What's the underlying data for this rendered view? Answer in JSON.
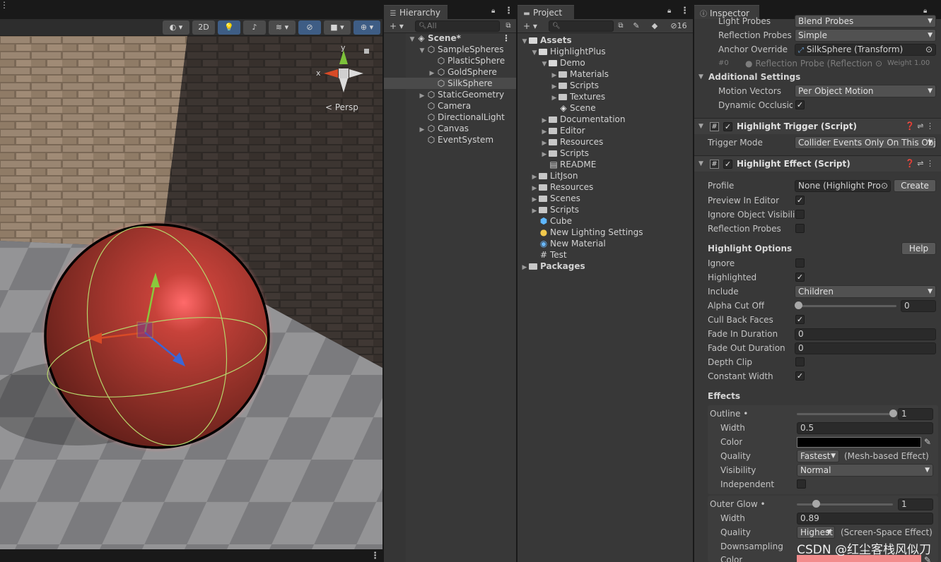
{
  "scene": {
    "toolbar": {
      "btn_2d": "2D"
    },
    "gizmo": {
      "y_label": "y",
      "x_label": "x",
      "persp_label": "< Persp"
    }
  },
  "hierarchy": {
    "tab_label": "Hierarchy",
    "search_placeholder": "All",
    "items": [
      {
        "label": "Scene*",
        "bold": true
      },
      {
        "label": "SampleSpheres"
      },
      {
        "label": "PlasticSphere"
      },
      {
        "label": "GoldSphere"
      },
      {
        "label": "SilkSphere",
        "selected": true
      },
      {
        "label": "StaticGeometry"
      },
      {
        "label": "Camera"
      },
      {
        "label": "DirectionalLight"
      },
      {
        "label": "Canvas"
      },
      {
        "label": "EventSystem"
      }
    ]
  },
  "project": {
    "tab_label": "Project",
    "hidden_count": "16",
    "items": [
      {
        "label": "Assets",
        "bold": true
      },
      {
        "label": "HighlightPlus"
      },
      {
        "label": "Demo"
      },
      {
        "label": "Materials"
      },
      {
        "label": "Scripts"
      },
      {
        "label": "Textures"
      },
      {
        "label": "Scene"
      },
      {
        "label": "Documentation"
      },
      {
        "label": "Editor"
      },
      {
        "label": "Resources"
      },
      {
        "label": "Scripts"
      },
      {
        "label": "README"
      },
      {
        "label": "LitJson"
      },
      {
        "label": "Resources"
      },
      {
        "label": "Scenes"
      },
      {
        "label": "Scripts"
      },
      {
        "label": "Cube"
      },
      {
        "label": "New Lighting Settings"
      },
      {
        "label": "New Material"
      },
      {
        "label": "Test"
      },
      {
        "label": "Packages",
        "bold": true
      }
    ]
  },
  "inspector": {
    "tab_label": "Inspector",
    "light_probes": {
      "label": "Light Probes",
      "value": "Blend Probes"
    },
    "reflection_probes": {
      "label": "Reflection Probes",
      "value": "Simple"
    },
    "anchor_override": {
      "label": "Anchor Override",
      "value": "SilkSphere (Transform)"
    },
    "probe_line": {
      "index": "#0",
      "value": "Reflection Probe (Reflection P",
      "weight": "Weight 1.00"
    },
    "additional_settings": "Additional Settings",
    "motion_vectors": {
      "label": "Motion Vectors",
      "value": "Per Object Motion"
    },
    "dynamic_occlusion": {
      "label": "Dynamic Occlusion"
    },
    "trigger_component": {
      "title": "Highlight Trigger (Script)"
    },
    "trigger_mode": {
      "label": "Trigger Mode",
      "value": "Collider Events Only On This Obj"
    },
    "effect_component": {
      "title": "Highlight Effect (Script)"
    },
    "profile": {
      "label": "Profile",
      "value": "None (Highlight Profi",
      "create": "Create"
    },
    "preview_in_editor": "Preview In Editor",
    "ignore_object_visibility": "Ignore Object Visibility",
    "reflection_probes_toggle": "Reflection Probes",
    "highlight_options": {
      "title": "Highlight Options",
      "help": "Help"
    },
    "ignore": "Ignore",
    "highlighted": "Highlighted",
    "include": {
      "label": "Include",
      "value": "Children"
    },
    "alpha_cut_off": {
      "label": "Alpha Cut Off",
      "value": "0",
      "fraction": 0.0
    },
    "cull_back_faces": "Cull Back Faces",
    "fade_in_duration": {
      "label": "Fade In Duration",
      "value": "0"
    },
    "fade_out_duration": {
      "label": "Fade Out Duration",
      "value": "0"
    },
    "depth_clip": "Depth Clip",
    "constant_width": "Constant Width",
    "effects_title": "Effects",
    "outline": {
      "label": "Outline •",
      "value": "1",
      "fraction": 1.0,
      "width_label": "Width",
      "width": "0.5",
      "color_label": "Color",
      "color": "#000000",
      "quality_label": "Quality",
      "quality": "Fastest",
      "quality_note": "(Mesh-based Effect)",
      "visibility_label": "Visibility",
      "visibility": "Normal",
      "independent_label": "Independent"
    },
    "outer_glow": {
      "label": "Outer Glow •",
      "value": "1",
      "fraction": 0.2,
      "width_label": "Width",
      "width": "0.89",
      "quality_label": "Quality",
      "quality": "Highest",
      "quality_note": "(Screen-Space Effect)",
      "downsampling_label": "Downsampling",
      "color_label": "Color",
      "color": "#f28c8c"
    }
  },
  "watermark": "CSDN @红尘客栈风似刀"
}
